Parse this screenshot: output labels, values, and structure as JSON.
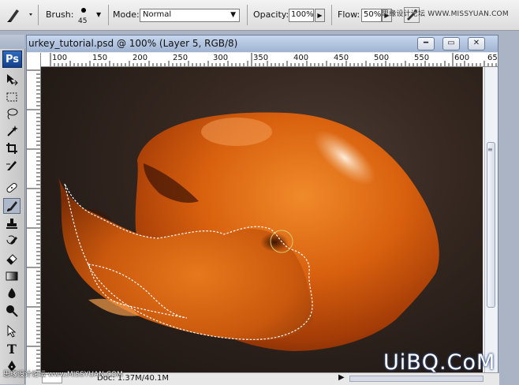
{
  "options_bar": {
    "brush_label": "Brush:",
    "brush_size": "45",
    "mode_label": "Mode:",
    "mode_value": "Normal",
    "opacity_label": "Opacity:",
    "opacity_value": "100%",
    "flow_label": "Flow:",
    "flow_value": "50%"
  },
  "toolbox": {
    "logo": "Ps",
    "tools": [
      "move-tool",
      "marquee-tool",
      "lasso-tool",
      "magic-wand-tool",
      "crop-tool",
      "slice-tool",
      "healing-brush-tool",
      "brush-tool",
      "clone-stamp-tool",
      "history-brush-tool",
      "eraser-tool",
      "gradient-tool",
      "blur-tool",
      "dodge-tool",
      "path-selection-tool",
      "type-tool",
      "pen-tool"
    ],
    "selected_tool": "brush-tool",
    "type_tool_glyph": "T"
  },
  "document": {
    "title": "urkey_tutorial.psd @ 100% (Layer 5, RGB/8)",
    "window_buttons": [
      "minimize",
      "maximize",
      "close"
    ],
    "ruler_labels": [
      "100",
      "150",
      "200",
      "250",
      "300",
      "350",
      "400",
      "450",
      "500",
      "550",
      "600",
      "65"
    ],
    "status": {
      "doc_info": "Doc: 1.37M/40.1M"
    }
  },
  "watermarks": {
    "top": "思缘设计论坛 WWW.MISSYUAN.COM",
    "bottom": "思缘设计论坛 www.MISSYUAN.COM",
    "logo": "UiBQ.CoM"
  },
  "colors": {
    "canvas_dark": "#1b1412",
    "turkey_main": "#d9650f",
    "turkey_highlight": "#f7c79a",
    "title_bar": "#b3c5e2"
  }
}
